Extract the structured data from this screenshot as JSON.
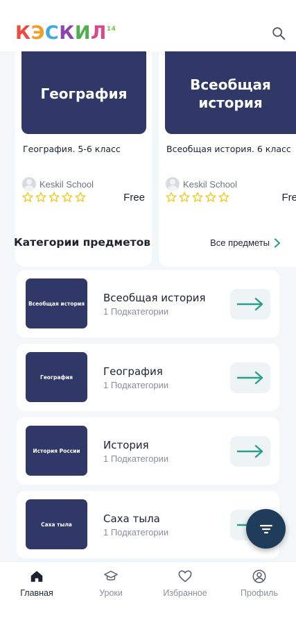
{
  "header": {
    "logo_letters": [
      "К",
      "Э",
      "С",
      "К",
      "И",
      "Л"
    ],
    "logo_colors": [
      "#e94b3c",
      "#f29c2b",
      "#3fa9e0",
      "#8e44ad",
      "#4caf50",
      "#d64a8c"
    ],
    "logo_superscript": "14",
    "search_icon": "search-icon"
  },
  "courses": [
    {
      "thumb_title": "География",
      "title": "География. 5-6 класс",
      "author": "Keskil School",
      "rating": 0,
      "price": "Free"
    },
    {
      "thumb_title": "Всеобщая история",
      "title": "Всеобщая история. 6 класс",
      "author": "Keskil School",
      "rating": 0,
      "price": "Fre"
    }
  ],
  "categories_section": {
    "title": "Категории предметов",
    "all_link": "Все предметы"
  },
  "categories": [
    {
      "thumb_text": "Всеобщая история",
      "name": "Всеобщая история",
      "sub": "1 Подкатегории"
    },
    {
      "thumb_text": "География",
      "name": "География",
      "sub": "1 Подкатегории"
    },
    {
      "thumb_text": "История России",
      "name": "История",
      "sub": "1 Подкатегории"
    },
    {
      "thumb_text": "Саха тыла",
      "name": "Саха тыла",
      "sub": "1 Подкатегории"
    }
  ],
  "fab": {
    "icon": "filter-icon"
  },
  "nav": [
    {
      "label": "Главная",
      "icon": "home-icon",
      "active": true
    },
    {
      "label": "Уроки",
      "icon": "graduation-cap-icon",
      "active": false
    },
    {
      "label": "Избранное",
      "icon": "heart-icon",
      "active": false
    },
    {
      "label": "Профиль",
      "icon": "profile-icon",
      "active": false
    }
  ],
  "colors": {
    "accent": "#2a9d8f",
    "thumb_bg": "#2f3867",
    "star": "#f2c200"
  }
}
